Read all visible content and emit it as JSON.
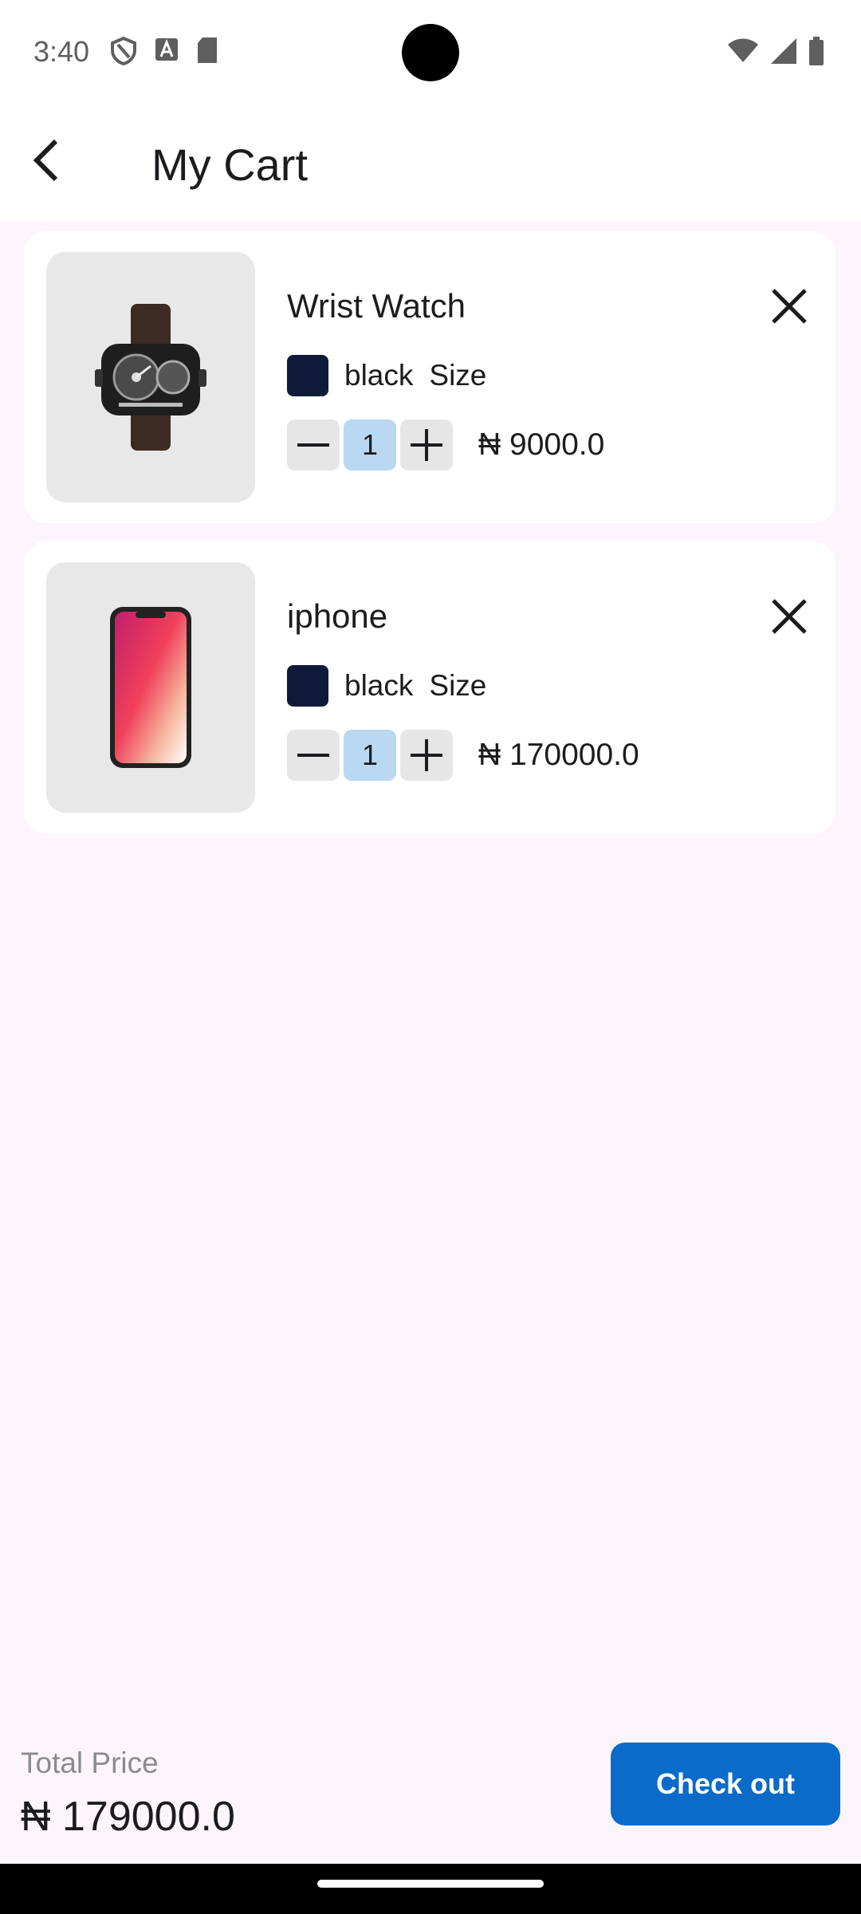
{
  "status_bar": {
    "time": "3:40",
    "left_icons": [
      "shield-icon",
      "text-a-icon",
      "sd-card-icon"
    ],
    "right_icons": [
      "wifi-icon",
      "signal-icon",
      "battery-icon"
    ]
  },
  "app_bar": {
    "title": "My Cart",
    "back_icon": "chevron-left-icon"
  },
  "cart": {
    "items": [
      {
        "name": "Wrist Watch",
        "image_icon": "wrist-watch-image",
        "color_name": "black",
        "color_hex": "#0f1a3a",
        "size_label": "Size",
        "quantity": "1",
        "price": "₦ 9000.0"
      },
      {
        "name": "iphone",
        "image_icon": "iphone-image",
        "color_name": "black",
        "color_hex": "#0f1a3a",
        "size_label": "Size",
        "quantity": "1",
        "price": "₦ 170000.0"
      }
    ]
  },
  "footer": {
    "total_label": "Total Price",
    "total_value": "₦ 179000.0",
    "checkout_label": "Check out"
  },
  "colors": {
    "accent": "#0a6bc8",
    "background": "#fcf6fc",
    "quantity_highlight": "#b9d9f2"
  }
}
